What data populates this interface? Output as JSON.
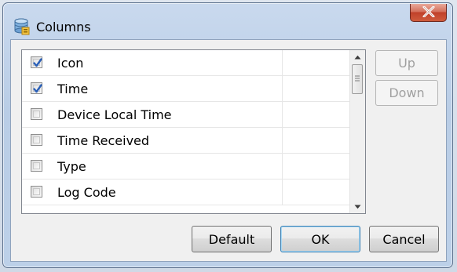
{
  "window": {
    "title": "Columns",
    "close_glyph": "X"
  },
  "columns_list": {
    "items": [
      {
        "label": "Icon",
        "checked": true
      },
      {
        "label": "Time",
        "checked": true
      },
      {
        "label": "Device Local Time",
        "checked": false
      },
      {
        "label": "Time Received",
        "checked": false
      },
      {
        "label": "Type",
        "checked": false
      },
      {
        "label": "Log Code",
        "checked": false
      }
    ]
  },
  "side_buttons": {
    "up_label": "Up",
    "down_label": "Down"
  },
  "footer_buttons": {
    "default_label": "Default",
    "ok_label": "OK",
    "cancel_label": "Cancel"
  },
  "icons": {
    "title_icon": "database-columns-icon",
    "close": "close-icon",
    "check": "checkmark-icon",
    "scroll_up": "scroll-up-arrow-icon",
    "scroll_down": "scroll-down-arrow-icon",
    "scroll_grip": "scroll-grip-icon"
  },
  "colors": {
    "close_button": "#c0412a",
    "check": "#2a5fb7"
  }
}
